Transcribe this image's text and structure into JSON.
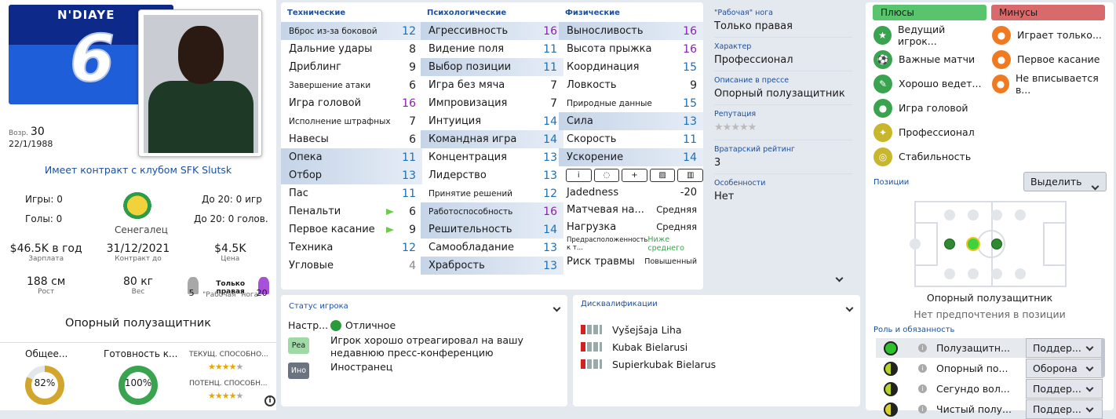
{
  "profile": {
    "name": "N'DIAYE",
    "number": "6",
    "age_label": "Возр.",
    "age": "30",
    "dob": "22/1/1988",
    "contract_text": "Имеет контракт с клубом SFK Slutsk",
    "games_label": "Игры: 0",
    "goals_label": "Голы: 0",
    "u20_games": "До 20: 0 игр",
    "u20_goals": "До 20: 0 голов.",
    "nation": "Сенегалец",
    "wage": "$46.5K в год",
    "wage_label": "Зарплата",
    "contract_end": "31/12/2021",
    "contract_end_label": "Контракт до",
    "value": "$4.5K",
    "value_label": "Цена",
    "height": "188 см",
    "height_label": "Рост",
    "weight": "80 кг",
    "weight_label": "Вес",
    "foot_text": "Только правая",
    "foot_label": "\"Рабочая\" нога",
    "left_foot_val": "5",
    "right_foot_val": "20",
    "position": "Опорный полузащитник",
    "overall_label": "Общее...",
    "overall_pct": "82%",
    "overall_value": 82,
    "ready_label": "Готовность к...",
    "ready_pct": "100%",
    "ready_value": 100,
    "cur_ability_label": "ТЕКУЩ. СПОСОБНО...",
    "pot_ability_label": "ПОТЕНЦ. СПОСОБН...",
    "cur_stars": 4,
    "pot_stars": 4
  },
  "technical": {
    "title": "Технические",
    "items": [
      {
        "n": "Вброс из-за боковой",
        "v": "12",
        "c": "b",
        "hl": true,
        "sm": true
      },
      {
        "n": "Дальние удары",
        "v": "8",
        "c": "k"
      },
      {
        "n": "Дриблинг",
        "v": "9",
        "c": "k"
      },
      {
        "n": "Завершение атаки",
        "v": "6",
        "c": "k",
        "sm": true
      },
      {
        "n": "Игра головой",
        "v": "16",
        "c": "p"
      },
      {
        "n": "Исполнение штрафных",
        "v": "7",
        "c": "k",
        "sm": true
      },
      {
        "n": "Навесы",
        "v": "6",
        "c": "k"
      },
      {
        "n": "Опека",
        "v": "11",
        "c": "b",
        "hl": true
      },
      {
        "n": "Отбор",
        "v": "13",
        "c": "b",
        "hl": true
      },
      {
        "n": "Пас",
        "v": "11",
        "c": "b"
      },
      {
        "n": "Пенальти",
        "v": "6",
        "c": "k",
        "flag": true
      },
      {
        "n": "Первое касание",
        "v": "9",
        "c": "k",
        "flag": true
      },
      {
        "n": "Техника",
        "v": "12",
        "c": "b"
      },
      {
        "n": "Угловые",
        "v": "4",
        "c": "g"
      }
    ]
  },
  "mental": {
    "title": "Психологические",
    "items": [
      {
        "n": "Агрессивность",
        "v": "16",
        "c": "p",
        "hl": true
      },
      {
        "n": "Видение поля",
        "v": "11",
        "c": "b"
      },
      {
        "n": "Выбор позиции",
        "v": "11",
        "c": "b",
        "hl": true
      },
      {
        "n": "Игра без мяча",
        "v": "7",
        "c": "k"
      },
      {
        "n": "Импровизация",
        "v": "7",
        "c": "k"
      },
      {
        "n": "Интуиция",
        "v": "14",
        "c": "b"
      },
      {
        "n": "Командная игра",
        "v": "14",
        "c": "b",
        "hl": true
      },
      {
        "n": "Концентрация",
        "v": "13",
        "c": "b"
      },
      {
        "n": "Лидерство",
        "v": "13",
        "c": "b"
      },
      {
        "n": "Принятие решений",
        "v": "12",
        "c": "b",
        "sm": true
      },
      {
        "n": "Работоспособность",
        "v": "16",
        "c": "p",
        "hl": true,
        "sm": true
      },
      {
        "n": "Решительность",
        "v": "14",
        "c": "b",
        "hl": true
      },
      {
        "n": "Самообладание",
        "v": "13",
        "c": "b"
      },
      {
        "n": "Храбрость",
        "v": "13",
        "c": "b",
        "hl": true
      }
    ]
  },
  "physical": {
    "title": "Физические",
    "items": [
      {
        "n": "Выносливость",
        "v": "16",
        "c": "p",
        "hl": true
      },
      {
        "n": "Высота прыжка",
        "v": "16",
        "c": "p"
      },
      {
        "n": "Координация",
        "v": "15",
        "c": "b"
      },
      {
        "n": "Ловкость",
        "v": "9",
        "c": "k"
      },
      {
        "n": "Природные данные",
        "v": "15",
        "c": "b",
        "sm": true
      },
      {
        "n": "Сила",
        "v": "13",
        "c": "b",
        "hl": true
      },
      {
        "n": "Скорость",
        "v": "11",
        "c": "b"
      },
      {
        "n": "Ускорение",
        "v": "14",
        "c": "b",
        "hl": true
      }
    ],
    "icons": [
      "i",
      "◌",
      "+",
      "▨",
      "▥"
    ],
    "extra": [
      {
        "n": "Jadedness",
        "v": "-20"
      },
      {
        "n": "Матчевая на...",
        "v": "Средняя"
      },
      {
        "n": "Нагрузка",
        "v": "Средняя"
      },
      {
        "n": "Предрасположенность к т...",
        "v": "Ниже среднего"
      },
      {
        "n": "Риск травмы",
        "v": "Повышенный"
      }
    ]
  },
  "info": {
    "foot_label": "\"Рабочая\" нога",
    "foot": "Только правая",
    "character_label": "Характер",
    "character": "Профессионал",
    "press_label": "Описание в прессе",
    "press": "Опорный полузащитник",
    "reputation_label": "Репутация",
    "reputation_stars": 0,
    "gk_label": "Вратарский рейтинг",
    "gk": "3",
    "special_label": "Особенности",
    "special": "Нет"
  },
  "status": {
    "title": "Статус игрока",
    "cond_label": "Настр...",
    "cond": "Отличное",
    "rows": [
      {
        "tag": "Реа",
        "text": "Игрок хорошо отреагировал на вашу недавнюю пресс-конференцию"
      },
      {
        "tag": "Ино",
        "text": "Иностранец"
      }
    ]
  },
  "disq": {
    "title": "Дисквалификации",
    "items": [
      "Vyšejšaja Liha",
      "Kubak Bielarusi",
      "Supierkubak Bielarus"
    ]
  },
  "traits": {
    "plus_label": "Плюсы",
    "minus_label": "Минусы",
    "plus": [
      {
        "t": "Ведущий игрок...",
        "ic": "★",
        "c": "#3aa34f"
      },
      {
        "t": "Важные матчи",
        "ic": "⚽",
        "c": "#3aa34f"
      },
      {
        "t": "Хорошо ведет...",
        "ic": "✎",
        "c": "#3aa34f"
      },
      {
        "t": "Игра головой",
        "ic": "●",
        "c": "#3aa34f"
      },
      {
        "t": "Профессионал",
        "ic": "✦",
        "c": "#c8b62c"
      },
      {
        "t": "Стабильность",
        "ic": "◎",
        "c": "#c8b62c"
      }
    ],
    "minus": [
      {
        "t": "Играет только...",
        "ic": "●",
        "c": "#ef7a22"
      },
      {
        "t": "Первое касание",
        "ic": "●",
        "c": "#ef7a22"
      },
      {
        "t": "Не вписывается в...",
        "ic": "●",
        "c": "#ef7a22"
      }
    ]
  },
  "positions": {
    "title": "Позиции",
    "select_label": "Выделить",
    "main": "Опорный полузащитник",
    "pref": "Нет предпочтения в позиции"
  },
  "roles": {
    "title": "Роль и обязанность",
    "items": [
      {
        "role": "Полузащитн...",
        "duty": "Поддер...",
        "c": "#2ec12e"
      },
      {
        "role": "Опорный по...",
        "duty": "Оборона",
        "c": "#b9d22a"
      },
      {
        "role": "Сегундо вол...",
        "duty": "Поддер...",
        "c": "#b9d22a"
      },
      {
        "role": "Чистый полу...",
        "duty": "Поддер...",
        "c": "#d6d22a"
      }
    ]
  }
}
